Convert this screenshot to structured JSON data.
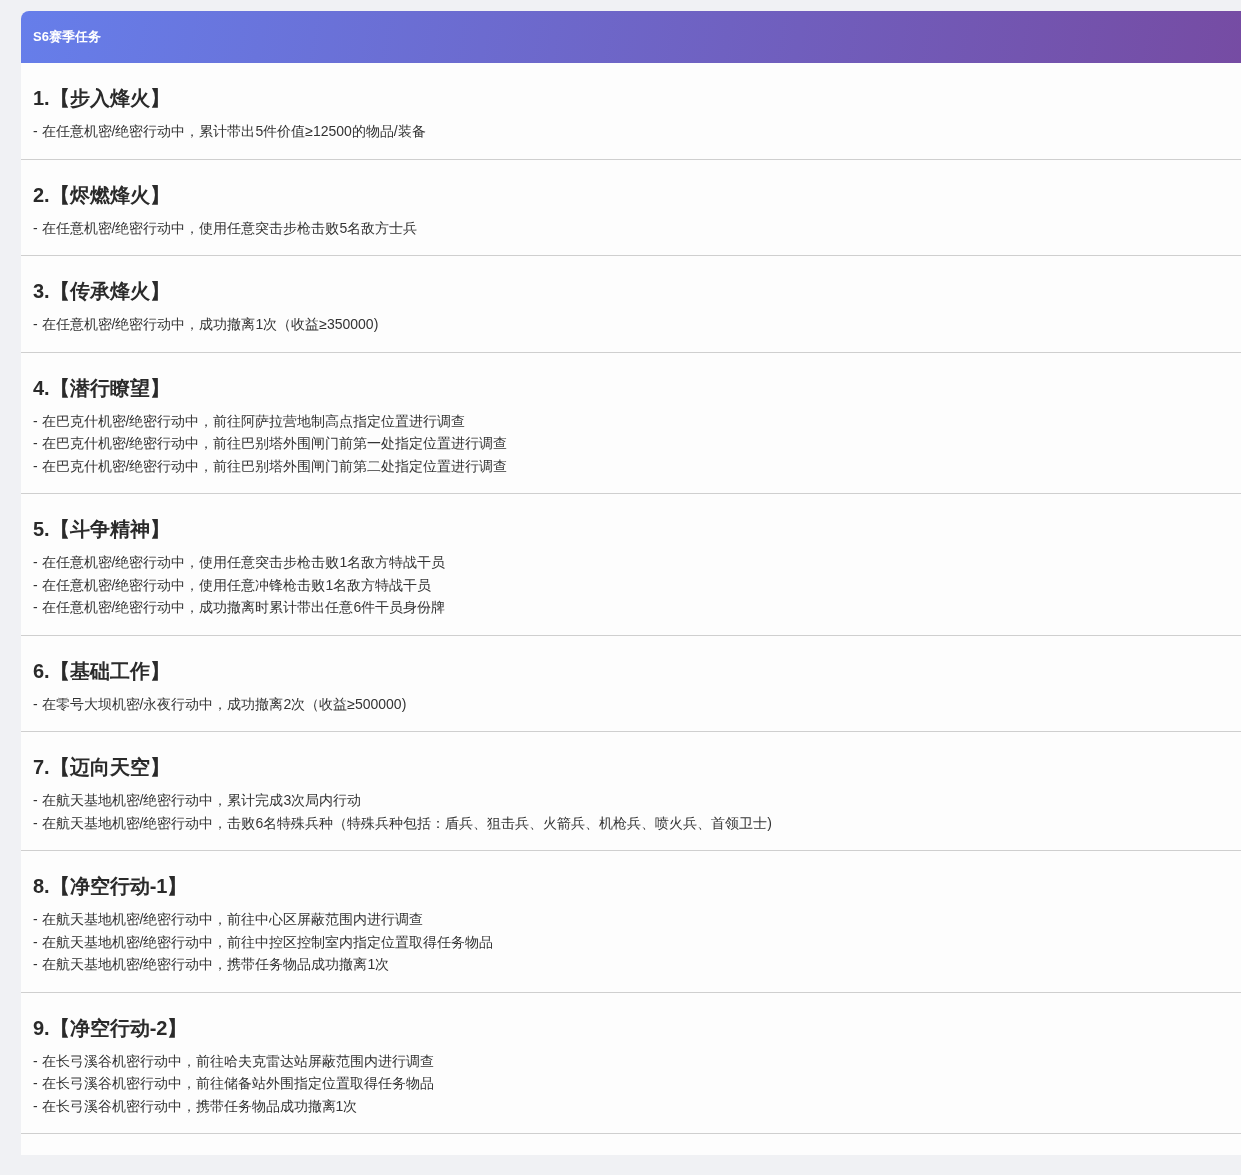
{
  "header": {
    "title": "S6赛季任务"
  },
  "tasks": [
    {
      "title": "1.【步入烽火】",
      "lines": [
        "- 在任意机密/绝密行动中，累计带出5件价值≥12500的物品/装备"
      ]
    },
    {
      "title": "2.【烬燃烽火】",
      "lines": [
        "- 在任意机密/绝密行动中，使用任意突击步枪击败5名敌方士兵"
      ]
    },
    {
      "title": "3.【传承烽火】",
      "lines": [
        "- 在任意机密/绝密行动中，成功撤离1次（收益≥350000)"
      ]
    },
    {
      "title": "4.【潜行瞭望】",
      "lines": [
        "- 在巴克什机密/绝密行动中，前往阿萨拉营地制高点指定位置进行调查",
        "- 在巴克什机密/绝密行动中，前往巴别塔外围闸门前第一处指定位置进行调查",
        "- 在巴克什机密/绝密行动中，前往巴别塔外围闸门前第二处指定位置进行调查"
      ]
    },
    {
      "title": "5.【斗争精神】",
      "lines": [
        "- 在任意机密/绝密行动中，使用任意突击步枪击败1名敌方特战干员",
        "- 在任意机密/绝密行动中，使用任意冲锋枪击败1名敌方特战干员",
        "- 在任意机密/绝密行动中，成功撤离时累计带出任意6件干员身份牌"
      ]
    },
    {
      "title": "6.【基础工作】",
      "lines": [
        "- 在零号大坝机密/永夜行动中，成功撤离2次（收益≥500000)"
      ]
    },
    {
      "title": "7.【迈向天空】",
      "lines": [
        "- 在航天基地机密/绝密行动中，累计完成3次局内行动",
        "- 在航天基地机密/绝密行动中，击败6名特殊兵种（特殊兵种包括：盾兵、狙击兵、火箭兵、机枪兵、喷火兵、首领卫士)"
      ]
    },
    {
      "title": "8.【净空行动-1】",
      "lines": [
        "- 在航天基地机密/绝密行动中，前往中心区屏蔽范围内进行调查",
        "- 在航天基地机密/绝密行动中，前往中控区控制室内指定位置取得任务物品",
        "- 在航天基地机密/绝密行动中，携带任务物品成功撤离1次"
      ]
    },
    {
      "title": "9.【净空行动-2】",
      "lines": [
        "- 在长弓溪谷机密行动中，前往哈夫克雷达站屏蔽范围内进行调查",
        "- 在长弓溪谷机密行动中，前往储备站外围指定位置取得任务物品",
        "- 在长弓溪谷机密行动中，携带任务物品成功撤离1次"
      ]
    }
  ]
}
